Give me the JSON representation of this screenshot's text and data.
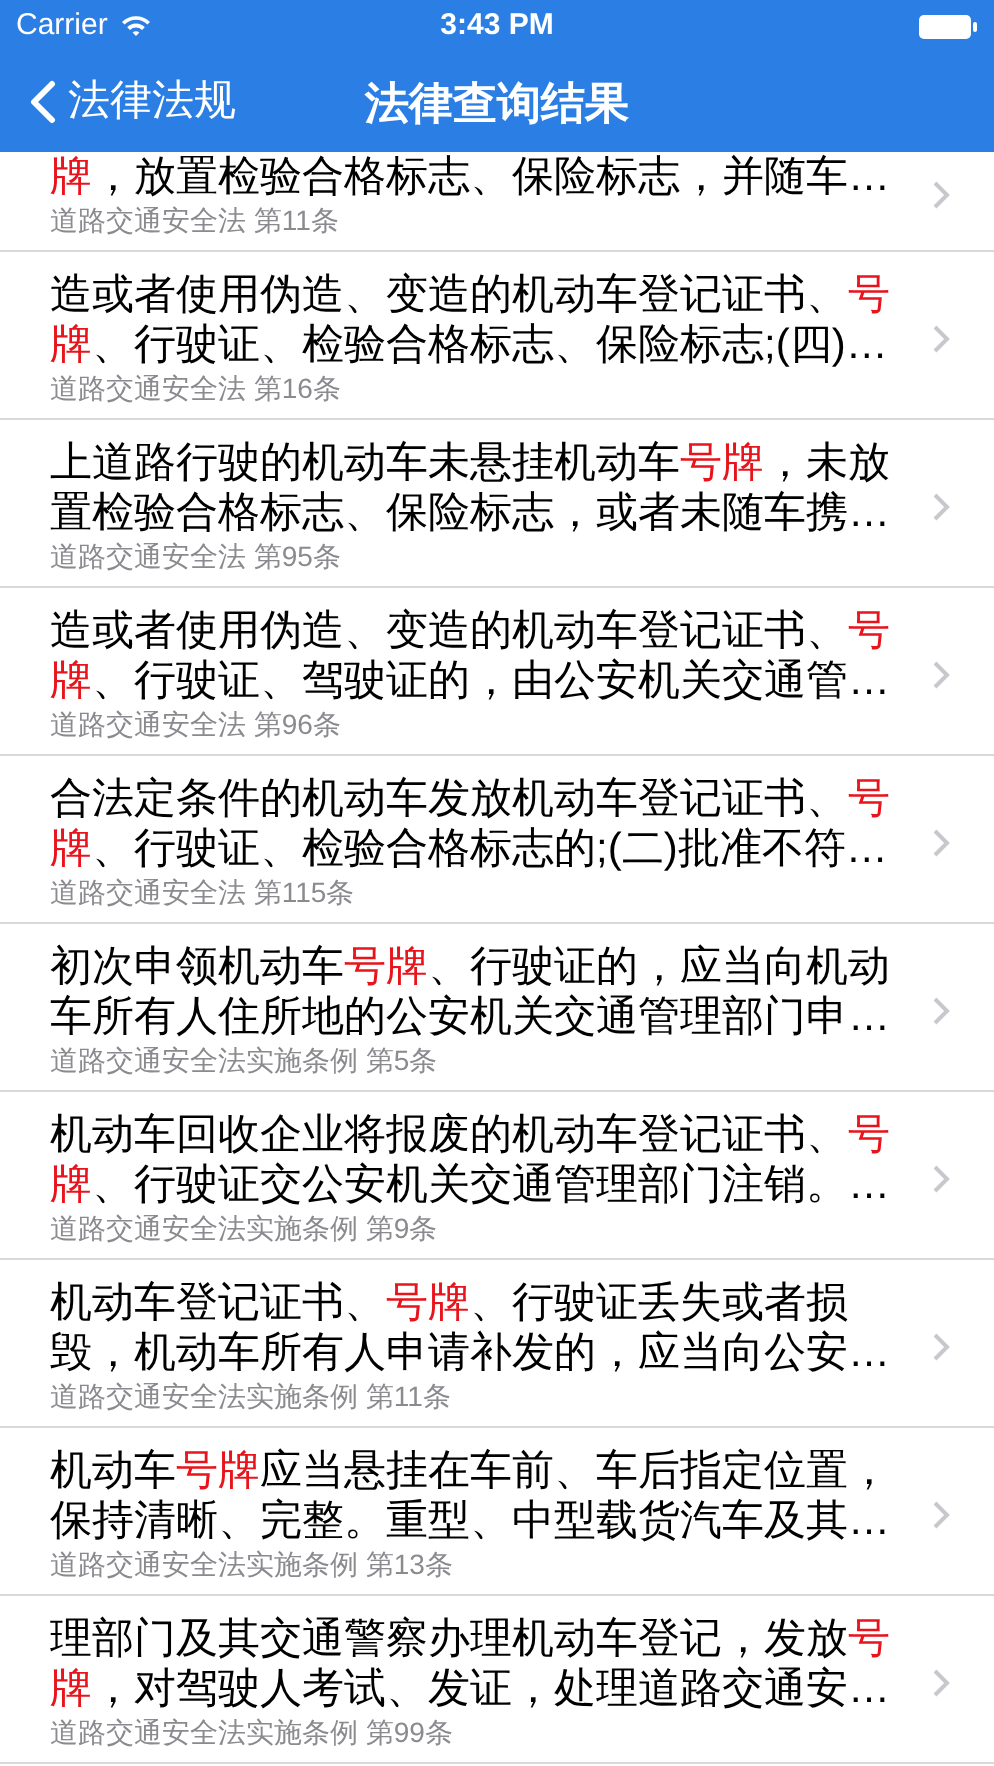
{
  "status_bar": {
    "carrier": "Carrier",
    "time": "3:43 PM"
  },
  "nav_bar": {
    "back_label": "法律法规",
    "title": "法律查询结果"
  },
  "results": [
    {
      "lines": [
        [
          {
            "text": "牌",
            "highlight": true
          },
          {
            "text": "，放置检验合格标志、保险标志，并随车…",
            "highlight": false
          }
        ]
      ],
      "source": "道路交通安全法 第11条"
    },
    {
      "lines": [
        [
          {
            "text": "造或者使用伪造、变造的机动车登记证书、",
            "highlight": false
          },
          {
            "text": "号",
            "highlight": true
          }
        ],
        [
          {
            "text": "牌",
            "highlight": true
          },
          {
            "text": "、行驶证、检验合格标志、保险标志;(四)…",
            "highlight": false
          }
        ]
      ],
      "source": "道路交通安全法 第16条"
    },
    {
      "lines": [
        [
          {
            "text": "上道路行驶的机动车未悬挂机动车",
            "highlight": false
          },
          {
            "text": "号牌",
            "highlight": true
          },
          {
            "text": "，未放",
            "highlight": false
          }
        ],
        [
          {
            "text": "置检验合格标志、保险标志，或者未随车携…",
            "highlight": false
          }
        ]
      ],
      "source": "道路交通安全法 第95条"
    },
    {
      "lines": [
        [
          {
            "text": "造或者使用伪造、变造的机动车登记证书、",
            "highlight": false
          },
          {
            "text": "号",
            "highlight": true
          }
        ],
        [
          {
            "text": "牌",
            "highlight": true
          },
          {
            "text": "、行驶证、驾驶证的，由公安机关交通管…",
            "highlight": false
          }
        ]
      ],
      "source": "道路交通安全法 第96条"
    },
    {
      "lines": [
        [
          {
            "text": "合法定条件的机动车发放机动车登记证书、",
            "highlight": false
          },
          {
            "text": "号",
            "highlight": true
          }
        ],
        [
          {
            "text": "牌",
            "highlight": true
          },
          {
            "text": "、行驶证、检验合格标志的;(二)批准不符…",
            "highlight": false
          }
        ]
      ],
      "source": "道路交通安全法 第115条"
    },
    {
      "lines": [
        [
          {
            "text": "初次申领机动车",
            "highlight": false
          },
          {
            "text": "号牌",
            "highlight": true
          },
          {
            "text": "、行驶证的，应当向机动",
            "highlight": false
          }
        ],
        [
          {
            "text": "车所有人住所地的公安机关交通管理部门申…",
            "highlight": false
          }
        ]
      ],
      "source": "道路交通安全法实施条例 第5条"
    },
    {
      "lines": [
        [
          {
            "text": "机动车回收企业将报废的机动车登记证书、",
            "highlight": false
          },
          {
            "text": "号",
            "highlight": true
          }
        ],
        [
          {
            "text": "牌",
            "highlight": true
          },
          {
            "text": "、行驶证交公安机关交通管理部门注销。…",
            "highlight": false
          }
        ]
      ],
      "source": "道路交通安全法实施条例 第9条"
    },
    {
      "lines": [
        [
          {
            "text": "机动车登记证书、",
            "highlight": false
          },
          {
            "text": "号牌",
            "highlight": true
          },
          {
            "text": "、行驶证丢失或者损",
            "highlight": false
          }
        ],
        [
          {
            "text": "毁，机动车所有人申请补发的，应当向公安…",
            "highlight": false
          }
        ]
      ],
      "source": "道路交通安全法实施条例 第11条"
    },
    {
      "lines": [
        [
          {
            "text": "机动车",
            "highlight": false
          },
          {
            "text": "号牌",
            "highlight": true
          },
          {
            "text": "应当悬挂在车前、车后指定位置，",
            "highlight": false
          }
        ],
        [
          {
            "text": "保持清晰、完整。重型、中型载货汽车及其…",
            "highlight": false
          }
        ]
      ],
      "source": "道路交通安全法实施条例 第13条"
    },
    {
      "lines": [
        [
          {
            "text": "理部门及其交通警察办理机动车登记，发放",
            "highlight": false
          },
          {
            "text": "号",
            "highlight": true
          }
        ],
        [
          {
            "text": "牌",
            "highlight": true
          },
          {
            "text": "，对驾驶人考试、发证，处理道路交通安…",
            "highlight": false
          }
        ]
      ],
      "source": "道路交通安全法实施条例 第99条"
    }
  ]
}
